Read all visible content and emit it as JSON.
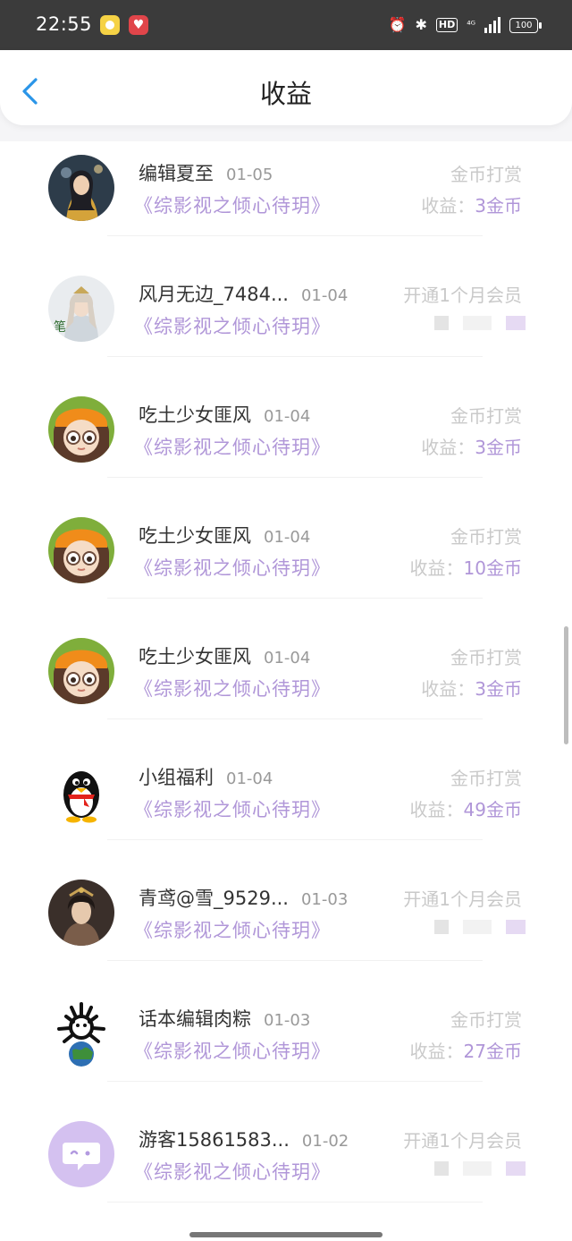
{
  "status_bar": {
    "time": "22:55",
    "signal": "⁴ᴳ",
    "battery": "100"
  },
  "header": {
    "title": "收益"
  },
  "items": [
    {
      "name": "编辑夏至",
      "date": "01-05",
      "book": "《综影视之倾心待玥》",
      "type": "金币打赏",
      "earn_label": "收益：",
      "earn_value": "3金币",
      "avatar": "photo-woman"
    },
    {
      "name": "风月无边_7484...",
      "date": "01-04",
      "book": "《综影视之倾心待玥》",
      "type": "开通1个月会员",
      "earn_label": "",
      "earn_value": "",
      "avatar": "illustration-man"
    },
    {
      "name": "吃土少女匪风",
      "date": "01-04",
      "book": "《综影视之倾心待玥》",
      "type": "金币打赏",
      "earn_label": "收益：",
      "earn_value": "3金币",
      "avatar": "cartoon-girl"
    },
    {
      "name": "吃土少女匪风",
      "date": "01-04",
      "book": "《综影视之倾心待玥》",
      "type": "金币打赏",
      "earn_label": "收益：",
      "earn_value": "10金币",
      "avatar": "cartoon-girl"
    },
    {
      "name": "吃土少女匪风",
      "date": "01-04",
      "book": "《综影视之倾心待玥》",
      "type": "金币打赏",
      "earn_label": "收益：",
      "earn_value": "3金币",
      "avatar": "cartoon-girl"
    },
    {
      "name": "小组福利",
      "date": "01-04",
      "book": "《综影视之倾心待玥》",
      "type": "金币打赏",
      "earn_label": "收益：",
      "earn_value": "49金币",
      "avatar": "penguin"
    },
    {
      "name": "青鸢@雪_9529...",
      "date": "01-03",
      "book": "《综影视之倾心待玥》",
      "type": "开通1个月会员",
      "earn_label": "",
      "earn_value": "",
      "avatar": "painting-woman"
    },
    {
      "name": "话本编辑肉粽",
      "date": "01-03",
      "book": "《综影视之倾心待玥》",
      "type": "金币打赏",
      "earn_label": "收益：",
      "earn_value": "27金币",
      "avatar": "globe-creature"
    },
    {
      "name": "游客15861583...",
      "date": "01-02",
      "book": "《综影视之倾心待玥》",
      "type": "开通1个月会员",
      "earn_label": "",
      "earn_value": "",
      "avatar": "default-chat"
    }
  ]
}
